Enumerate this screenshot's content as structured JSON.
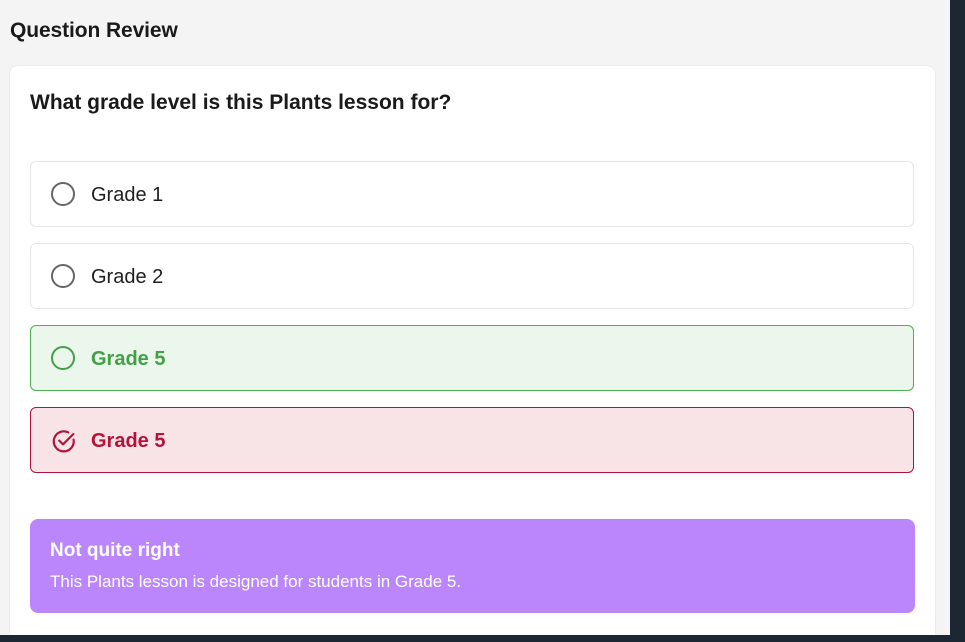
{
  "page": {
    "title": "Question Review"
  },
  "question": {
    "text": "What grade level is this Plants lesson for?",
    "options": [
      {
        "label": "Grade 1",
        "state": "unselected"
      },
      {
        "label": "Grade 2",
        "state": "unselected"
      },
      {
        "label": "Grade 5",
        "state": "correct"
      },
      {
        "label": "Grade 5",
        "state": "selected-incorrect"
      }
    ]
  },
  "feedback": {
    "title": "Not quite right",
    "message": "This Plants lesson is designed for students in Grade 5."
  },
  "colors": {
    "correct": "#43a047",
    "incorrect": "#b3123a",
    "feedback_bg": "#bb86fc"
  },
  "icons": {
    "unselected": "radio-empty-icon",
    "correct": "radio-empty-icon",
    "selected-incorrect": "check-circle-icon"
  }
}
